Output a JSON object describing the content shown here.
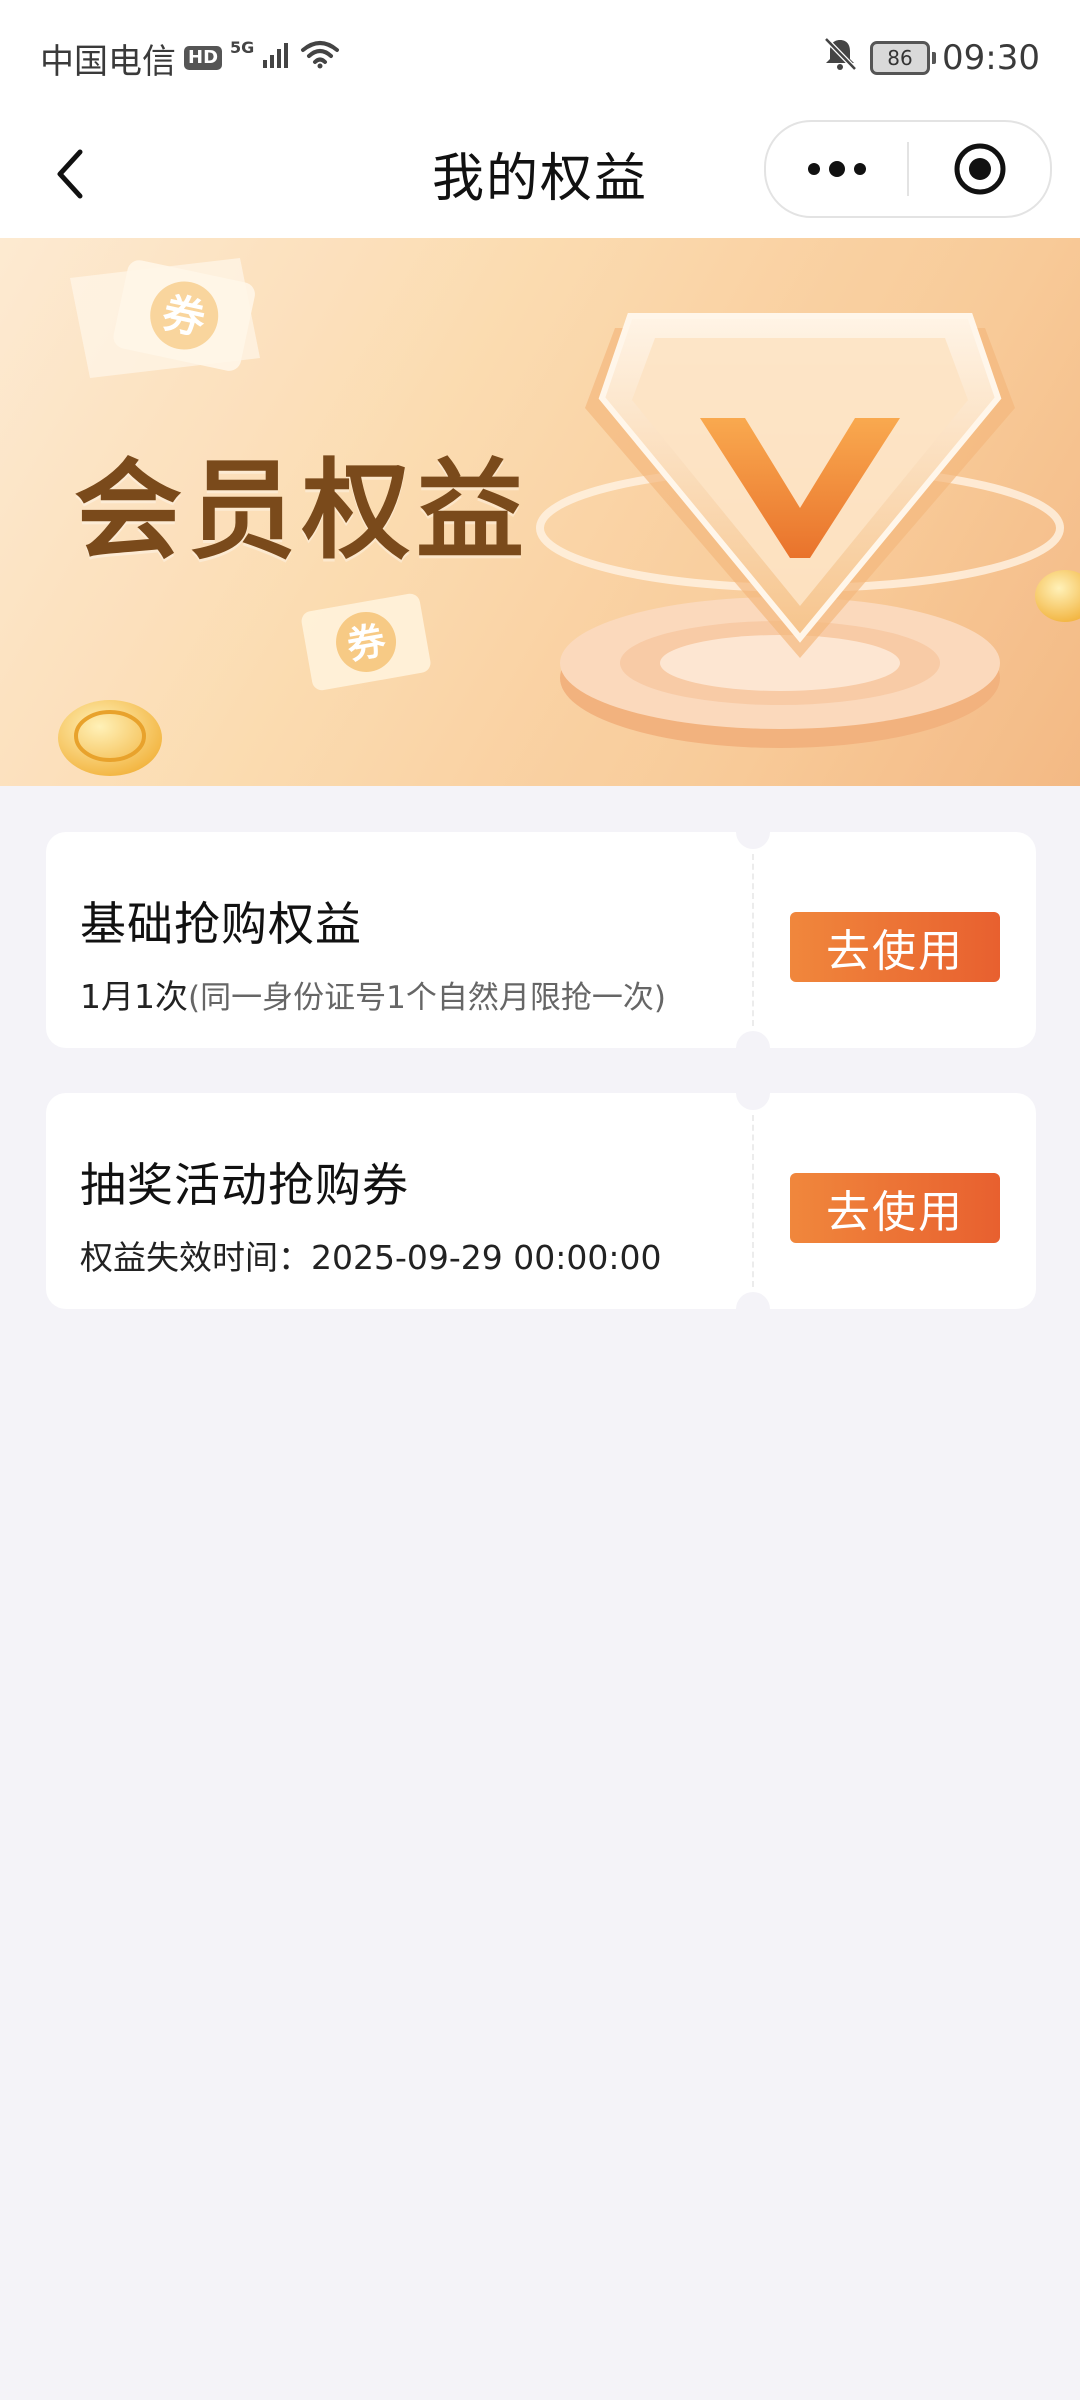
{
  "status_bar": {
    "carrier": "中国电信",
    "hd": "HD",
    "network": "5G",
    "battery": "86",
    "time": "09:30"
  },
  "nav": {
    "title": "我的权益"
  },
  "banner": {
    "title": "会员权益",
    "coupon_glyph": "券"
  },
  "benefits": [
    {
      "title": "基础抢购权益",
      "detail": "1月1次",
      "note": "(同一身份证号1个自然月限抢一次)",
      "button": "去使用"
    },
    {
      "title": "抽奖活动抢购券",
      "detail": "权益失效时间：2025-09-29 00:00:00",
      "note": "",
      "button": "去使用"
    }
  ],
  "colors": {
    "accent_start": "#f0873c",
    "accent_end": "#e8602f",
    "page_bg": "#f4f3f8",
    "banner_text": "#7a4a1b"
  }
}
